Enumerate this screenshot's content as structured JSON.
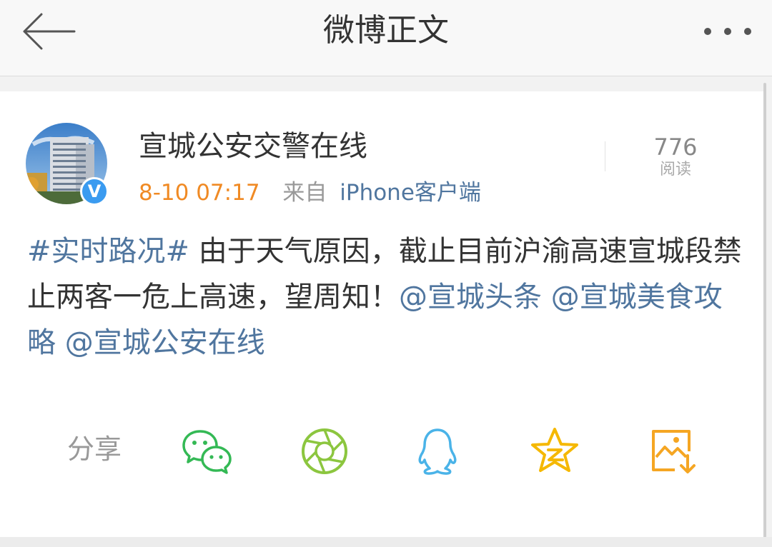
{
  "header": {
    "title": "微博正文",
    "back_icon": "arrow-left-icon",
    "more_icon": "more-dots-icon"
  },
  "post": {
    "author": "宣城公安交警在线",
    "time": "8-10 07:17",
    "source_prefix": "来自",
    "source_client": "iPhone客户端",
    "read_count": "776",
    "read_label": "阅读",
    "topic": "#实时路况#",
    "text": " 由于天气原因，截止目前沪渝高速宣城段禁止两客一危上高速，望周知！",
    "mentions": [
      "@宣城头条",
      "@宣城美食攻略",
      "@宣城公安在线"
    ]
  },
  "share": {
    "label": "分享",
    "targets": [
      {
        "name": "wechat-icon",
        "color": "#34b955"
      },
      {
        "name": "moments-icon",
        "color": "#8cc63f"
      },
      {
        "name": "qq-icon",
        "color": "#4ab3e8"
      },
      {
        "name": "qzone-icon",
        "color": "#f5b800"
      },
      {
        "name": "save-image-icon",
        "color": "#f5a623"
      }
    ]
  },
  "colors": {
    "link": "#50769f",
    "time": "#f08a24",
    "verified": "#3a9bf0"
  }
}
